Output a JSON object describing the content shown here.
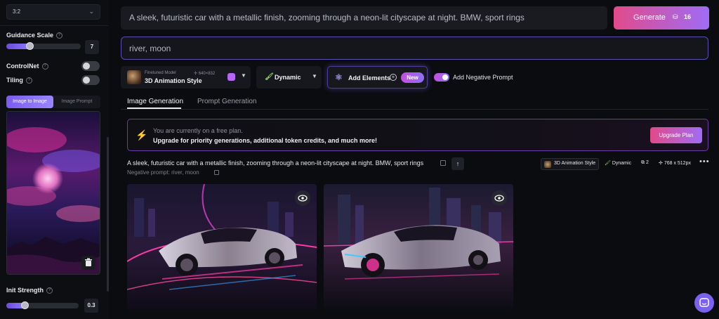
{
  "sidebar": {
    "aspect_ratio": "3:2",
    "guidance_scale": {
      "label": "Guidance Scale",
      "value": "7",
      "level": 0.5
    },
    "controlnet": {
      "label": "ControlNet",
      "enabled": false
    },
    "tiling": {
      "label": "Tiling",
      "enabled": false
    },
    "tabs": [
      "Image to Image",
      "Image Prompt"
    ],
    "init_strength": {
      "label": "Init Strength",
      "value": "0.3",
      "level": 0.3
    }
  },
  "prompt": {
    "text": "A sleek, futuristic car with a metallic finish, zooming through a neon-lit cityscape at night. BMW, sport rings",
    "negative": "river, moon"
  },
  "generate": {
    "label": "Generate",
    "tokens": "16"
  },
  "toolbar": {
    "model_subtitle": "Finetuned Model",
    "model_dims": "640×832",
    "model_name": "3D Animation Style",
    "style": "Dynamic",
    "elements_label": "Add Elements",
    "new_badge": "New",
    "negative_toggle_label": "Add Negative Prompt"
  },
  "tabs": [
    "Image Generation",
    "Prompt Generation"
  ],
  "banner": {
    "line1": "You are currently on a free plan.",
    "line2": "Upgrade for priority generations, additional token credits, and much more!",
    "button": "Upgrade Plan"
  },
  "generation": {
    "prompt": "A sleek, futuristic car with a metallic finish, zooming through a neon-lit cityscape at night. BMW, sport rings",
    "negative": "Negative prompt: river, moon",
    "model": "3D Animation Style",
    "style": "Dynamic",
    "count": "2",
    "size": "768 x 512px"
  },
  "colors": {
    "accent_start": "#e24a8a",
    "accent_end": "#9f6cf5",
    "slider": "#7b5cf0"
  }
}
